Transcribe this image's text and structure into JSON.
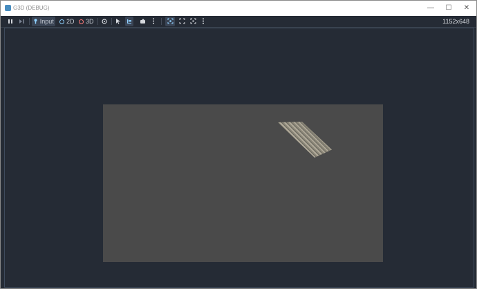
{
  "window": {
    "title": "G3D (DEBUG)",
    "controls": {
      "minimize": "—",
      "maximize": "☐",
      "close": "✕"
    }
  },
  "toolbar": {
    "pause_icon": "pause-icon",
    "step_icon": "step-icon",
    "input_label": "Input",
    "mode_2d_label": "2D",
    "mode_3d_label": "3D",
    "resolution": "1152x648"
  },
  "colors": {
    "window_bg": "#252b35",
    "canvas_bg": "#4a4a4a",
    "accent": "#478cbf",
    "mode_2d": "#8fd1ff",
    "mode_3d": "#ff7b7b"
  }
}
